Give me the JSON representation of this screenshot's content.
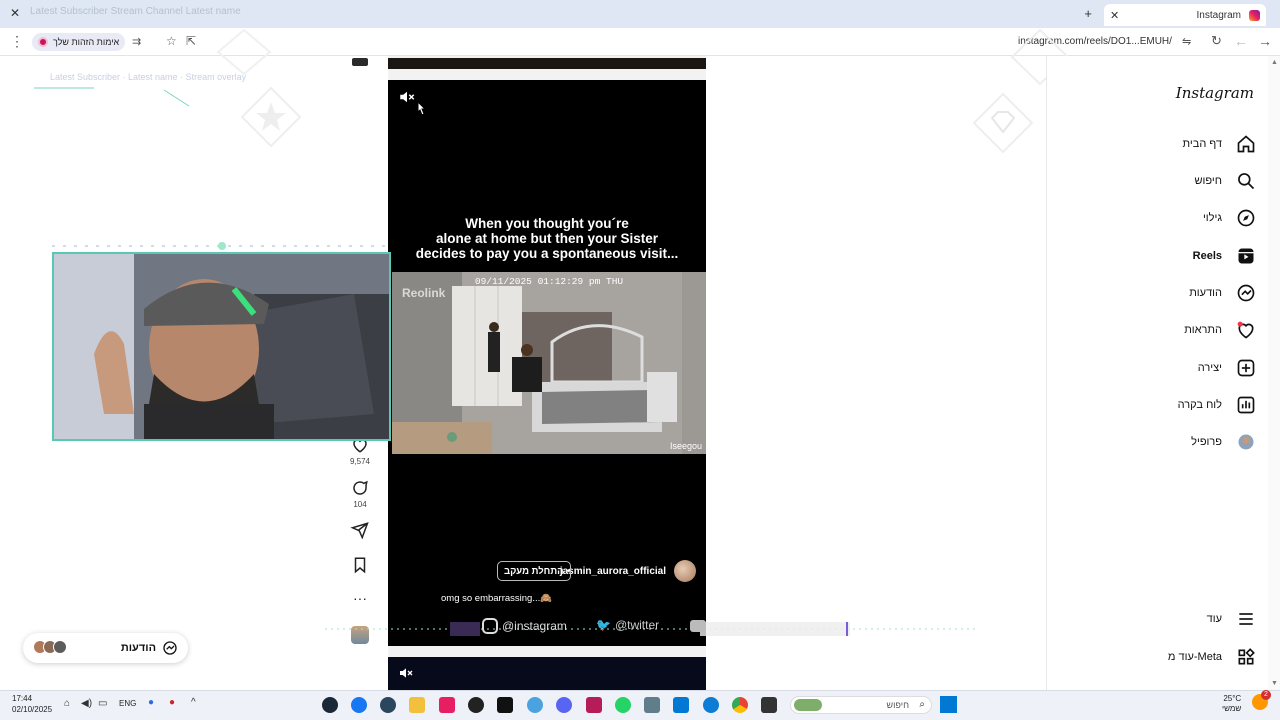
{
  "browser": {
    "tab_title": "Instagram",
    "url": "instagram.com/reels/DO1...EMUH/",
    "translate_chip": "אימות הזהות שלך",
    "window_title_ghost": "Latest Subscriber Stream Channel Latest name"
  },
  "reel": {
    "caption_overlay": "When you thought you´re\nalone at home but then your Sister\ndecides to pay you a spontaneous visit...",
    "cctv_timestamp": "09/11/2025 01:12:29 pm THU",
    "cctv_brand": "Reolink",
    "cctv_camera_name": "Iseegou",
    "author": "jasmin_aurora_official",
    "separator": "•",
    "follow_label": "התחלת מעקב",
    "post_caption": "omg so embarrassing...🙈"
  },
  "actions": {
    "likes": "9,574",
    "comments": "104"
  },
  "overlay": {
    "social_instagram": "@instagram",
    "social_twitter": "@twitter"
  },
  "messages_pill": {
    "label": "הודעות"
  },
  "nav": {
    "logo": "Instagram",
    "items": [
      {
        "label": "דף הבית",
        "icon": "home-icon"
      },
      {
        "label": "חיפוש",
        "icon": "search-icon"
      },
      {
        "label": "גילוי",
        "icon": "compass-icon"
      },
      {
        "label": "Reels",
        "icon": "reels-icon",
        "active": true
      },
      {
        "label": "הודעות",
        "icon": "messenger-icon"
      },
      {
        "label": "התראות",
        "icon": "heart-icon"
      },
      {
        "label": "יצירה",
        "icon": "plus-square-icon"
      },
      {
        "label": "לוח בקרה",
        "icon": "dashboard-icon"
      },
      {
        "label": "פרופיל",
        "icon": "profile-avatar-icon"
      }
    ],
    "more": "עוד",
    "meta_more": "עוד מ-Meta"
  },
  "taskbar": {
    "time": "17:44",
    "date": "02/10/2025",
    "lang": "ENG",
    "search_placeholder": "חיפוש",
    "weather": "25°C",
    "weather_desc": "שמשי",
    "badge": "2"
  },
  "colors": {
    "accent": "#58c7b4",
    "notification": "#ff3040",
    "reel_bg": "#000000"
  }
}
